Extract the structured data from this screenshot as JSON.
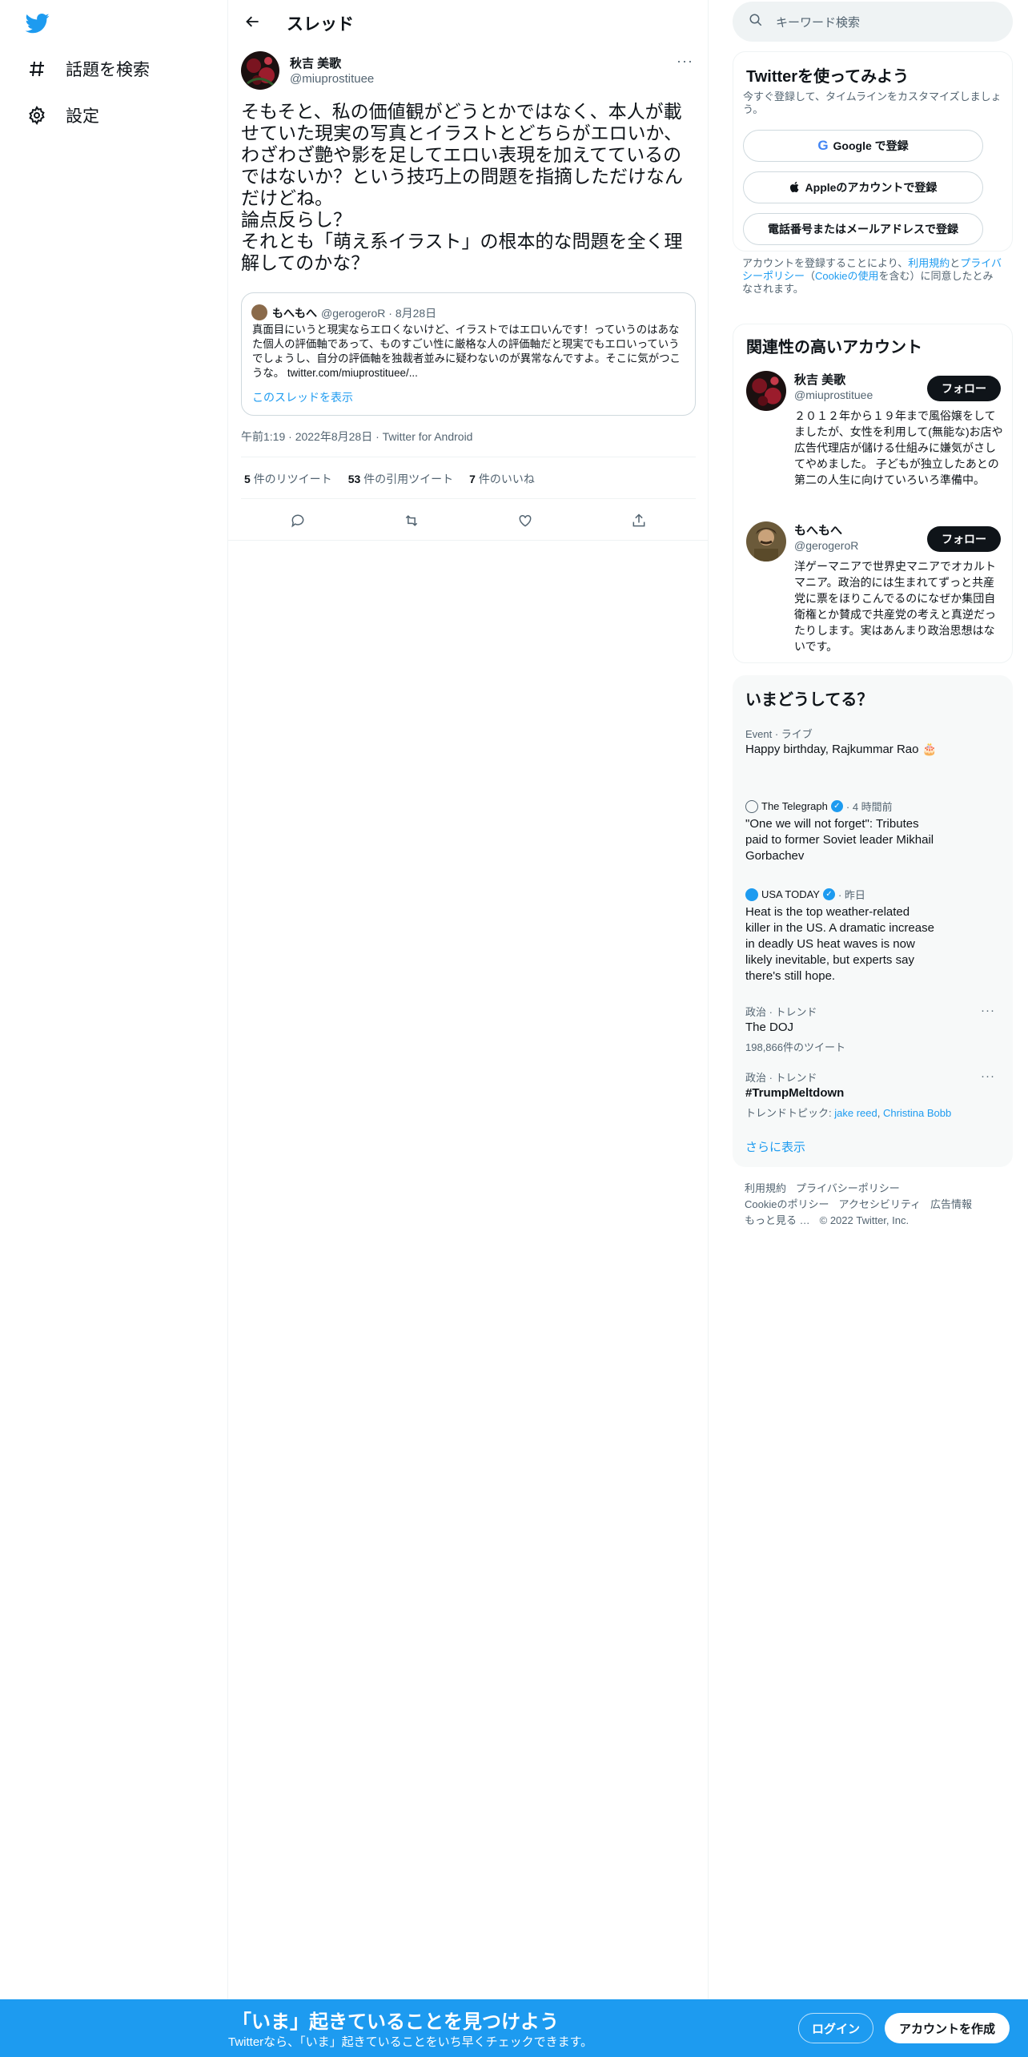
{
  "nav": {
    "items": [
      {
        "label": "話題を検索",
        "icon": "hashtag-icon"
      },
      {
        "label": "設定",
        "icon": "gear-icon"
      }
    ]
  },
  "header": {
    "title": "スレッド"
  },
  "tweet": {
    "author_name": "秋吉 美歌",
    "author_handle": "@miuprostituee",
    "text": "そもそと、私の価値観がどうとかではなく、本人が載せていた現実の写真とイラストとどちらがエロいか、わざわざ艶や影を足してエロい表現を加えてているのではないか？という技巧上の問題を指摘しただけなんだけどね。\n論点反らし？\nそれとも「萌え系イラスト」の根本的な問題を全く理解してのかな？",
    "quote": {
      "name": "もへもへ",
      "handle": "@gerogeroR",
      "date": "· 8月28日",
      "text": "真面目にいうと現実ならエロくないけど、イラストではエロいんです！っていうのはあなた個人の評価軸であって、ものすごい性に厳格な人の評価軸だと現実でもエロいっていうでしょうし、自分の評価軸を独裁者並みに疑わないのが異常なんですよ。そこに気がつこうな。 twitter.com/miuprostituee/...",
      "thread_link": "このスレッドを表示"
    },
    "meta": "午前1:19 · 2022年8月28日 · Twitter for Android",
    "stats": {
      "retweets_num": "5",
      "retweets_label": "件のリツイート",
      "quotes_num": "53",
      "quotes_label": "件の引用ツイート",
      "likes_num": "7",
      "likes_label": "件のいいね"
    }
  },
  "search": {
    "placeholder": "キーワード検索"
  },
  "signup_card": {
    "title": "Twitterを使ってみよう",
    "subtitle": "今すぐ登録して、タイムラインをカスタマイズしましょう。",
    "google_label": "Google で登録",
    "apple_label": "Appleのアカウントで登録",
    "phone_label": "電話番号またはメールアドレスで登録",
    "terms_prefix": "アカウントを登録することにより、",
    "terms_link1": "利用規約",
    "terms_and": "と",
    "terms_link2": "プライバシーポリシー",
    "terms_paren_open": "（",
    "terms_link3": "Cookieの使用",
    "terms_suffix": "を含む）に同意したとみなされます。"
  },
  "related": {
    "title": "関連性の高いアカウント",
    "follow_label": "フォロー",
    "accounts": [
      {
        "name": "秋吉 美歌",
        "handle": "@miuprostituee",
        "bio": "２０１２年から１９年まで風俗嬢をしてましたが、女性を利用して(無能な)お店や広告代理店が儲ける仕組みに嫌気がさしてやめました。 子どもが独立したあとの第二の人生に向けていろいろ準備中。"
      },
      {
        "name": "もへもへ",
        "handle": "@gerogeroR",
        "bio": "洋ゲーマニアで世界史マニアでオカルトマニア。政治的には生まれてずっと共産党に票をほりこんでるのになぜか集団自衛権とか賛成で共産党の考えと真逆だったりします。実はあんまり政治思想はないです。"
      }
    ]
  },
  "trends": {
    "title": "いまどうしてる？",
    "items": [
      {
        "meta": "Event · ライブ",
        "title": "Happy birthday, Rajkummar Rao 🎂"
      },
      {
        "source": "The Telegraph",
        "time": "· 4 時間前",
        "title": "\"One we will not forget\": Tributes paid to former Soviet leader Mikhail Gorbachev"
      },
      {
        "source": "USA TODAY",
        "time": "· 昨日",
        "title": "Heat is the top weather-related killer in the US. A dramatic increase in deadly US heat waves is now likely inevitable, but experts say there's still hope."
      },
      {
        "meta": "政治 · トレンド",
        "title": "The DOJ",
        "count": "198,866件のツイート"
      },
      {
        "meta": "政治 · トレンド",
        "title": "#TrumpMeltdown",
        "topics_label": "トレンドトピック:",
        "topic1": "jake reed",
        "topic2": "Christina Bobb"
      }
    ],
    "show_more": "さらに表示"
  },
  "footer": {
    "links": [
      "利用規約",
      "プライバシーポリシー",
      "Cookieのポリシー",
      "アクセシビリティ",
      "広告情報",
      "もっと見る …"
    ],
    "copyright": "© 2022 Twitter, Inc."
  },
  "bottom_bar": {
    "title": "「いま」起きていることを見つけよう",
    "subtitle": "Twitterなら、「いま」起きていることをいち早くチェックできます。",
    "login": "ログイン",
    "signup": "アカウントを作成"
  },
  "colors": {
    "accent": "#1d9bf0",
    "text": "#0f1419",
    "muted": "#536471",
    "border": "#eff3f4"
  }
}
